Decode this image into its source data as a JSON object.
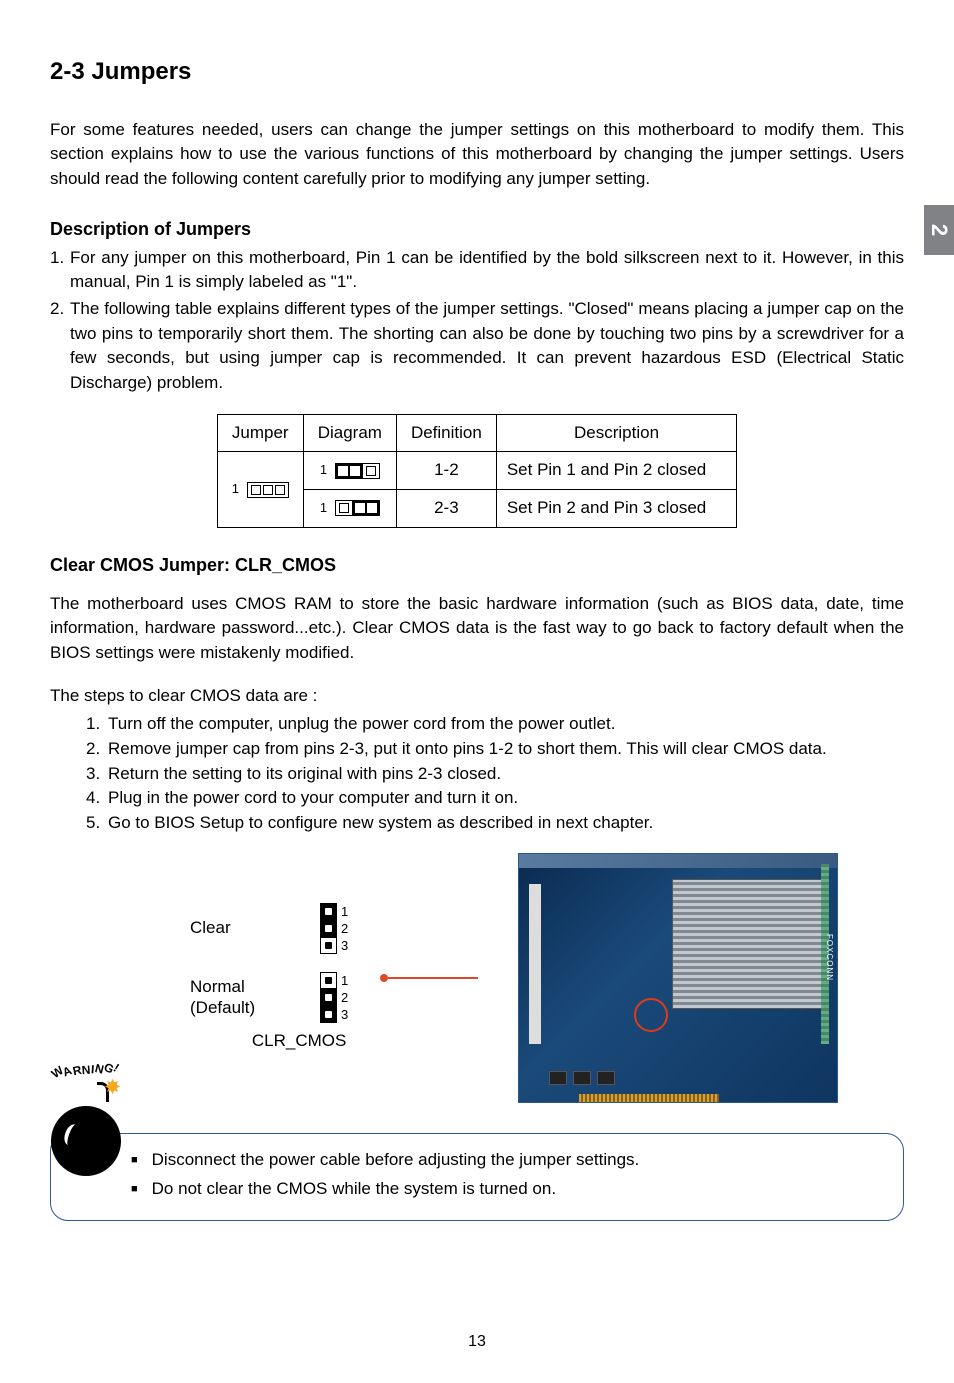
{
  "side_tab": "2",
  "section_title": "2-3 Jumpers",
  "intro": "For some features needed, users can change the jumper settings on this motherboard to modify them. This section explains how to use the various functions of this motherboard by changing the jumper settings. Users should read the following content carefully prior to modifying any jumper setting.",
  "desc_heading": "Description of Jumpers",
  "desc_item1": "For any jumper on this motherboard, Pin 1 can be identified by the bold silkscreen next to it. However, in this manual, Pin 1 is simply labeled as \"1\".",
  "desc_item2": "The following table explains different types of the jumper settings. \"Closed\" means placing a jumper cap on the two pins to temporarily short them. The shorting can also be done by touching two pins by a screwdriver for a few seconds, but using jumper cap is recommended. It can prevent hazardous ESD (Electrical Static Discharge) problem.",
  "table": {
    "h_jumper": "Jumper",
    "h_diagram": "Diagram",
    "h_definition": "Definition",
    "h_description": "Description",
    "r1_def": "1-2",
    "r1_desc": "Set Pin 1 and Pin 2 closed",
    "r2_def": "2-3",
    "r2_desc": "Set Pin 2 and Pin 3 closed",
    "pin1_label": "1"
  },
  "clr_heading": "Clear CMOS Jumper: CLR_CMOS",
  "clr_para": "The motherboard uses CMOS RAM to store the basic hardware information (such as BIOS data, date, time information, hardware password...etc.). Clear CMOS data is the fast way to go back to factory default when the BIOS settings were mistakenly modified.",
  "steps_intro": "The steps to clear CMOS data are :",
  "steps": {
    "s1": "Turn off the computer, unplug the power cord from the power outlet.",
    "s2": "Remove jumper cap from pins 2-3, put it onto pins 1-2 to short them. This will clear CMOS data.",
    "s3": "Return the setting to its original with pins 2-3 closed.",
    "s4": "Plug in the power cord to your computer and turn it on.",
    "s5": "Go to BIOS Setup to configure new system as described in next chapter."
  },
  "figure": {
    "clear_label": "Clear",
    "normal_label_l1": "Normal",
    "normal_label_l2": "(Default)",
    "clr_cmos_label": "CLR_CMOS",
    "pin1": "1",
    "pin2": "2",
    "pin3": "3",
    "foxconn": "FOXCONN"
  },
  "warning_label": "WARNING!",
  "warnings": {
    "w1": "Disconnect the power cable before adjusting the jumper settings.",
    "w2": "Do not clear the CMOS while the system is turned on."
  },
  "page_number": "13"
}
